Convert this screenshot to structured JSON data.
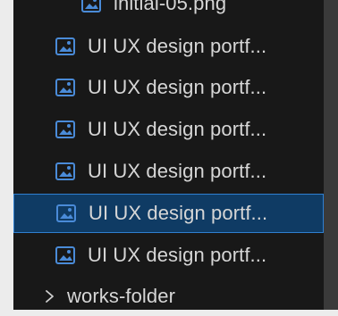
{
  "explorer": {
    "top_partial_file": "initial-05.png",
    "files": [
      {
        "name": "UI UX design portf...",
        "selected": false
      },
      {
        "name": "UI UX design portf...",
        "selected": false
      },
      {
        "name": "UI UX design portf...",
        "selected": false
      },
      {
        "name": "UI UX design portf...",
        "selected": false
      },
      {
        "name": "UI UX design portf...",
        "selected": true
      },
      {
        "name": "UI UX design portf...",
        "selected": false
      }
    ],
    "folder": {
      "name": "works-folder",
      "expanded": false
    }
  },
  "icons": {
    "file": "image-file-icon",
    "folder_toggle": "chevron-right-icon"
  },
  "colors": {
    "panel_bg": "#181818",
    "text": "#d6d6d6",
    "selected_bg": "#0f3b64",
    "selected_border": "#2f7fd0",
    "icon_blue": "#4a8bd8",
    "scrollbar": "#3a3a3a",
    "outer_bg": "#ececec"
  }
}
